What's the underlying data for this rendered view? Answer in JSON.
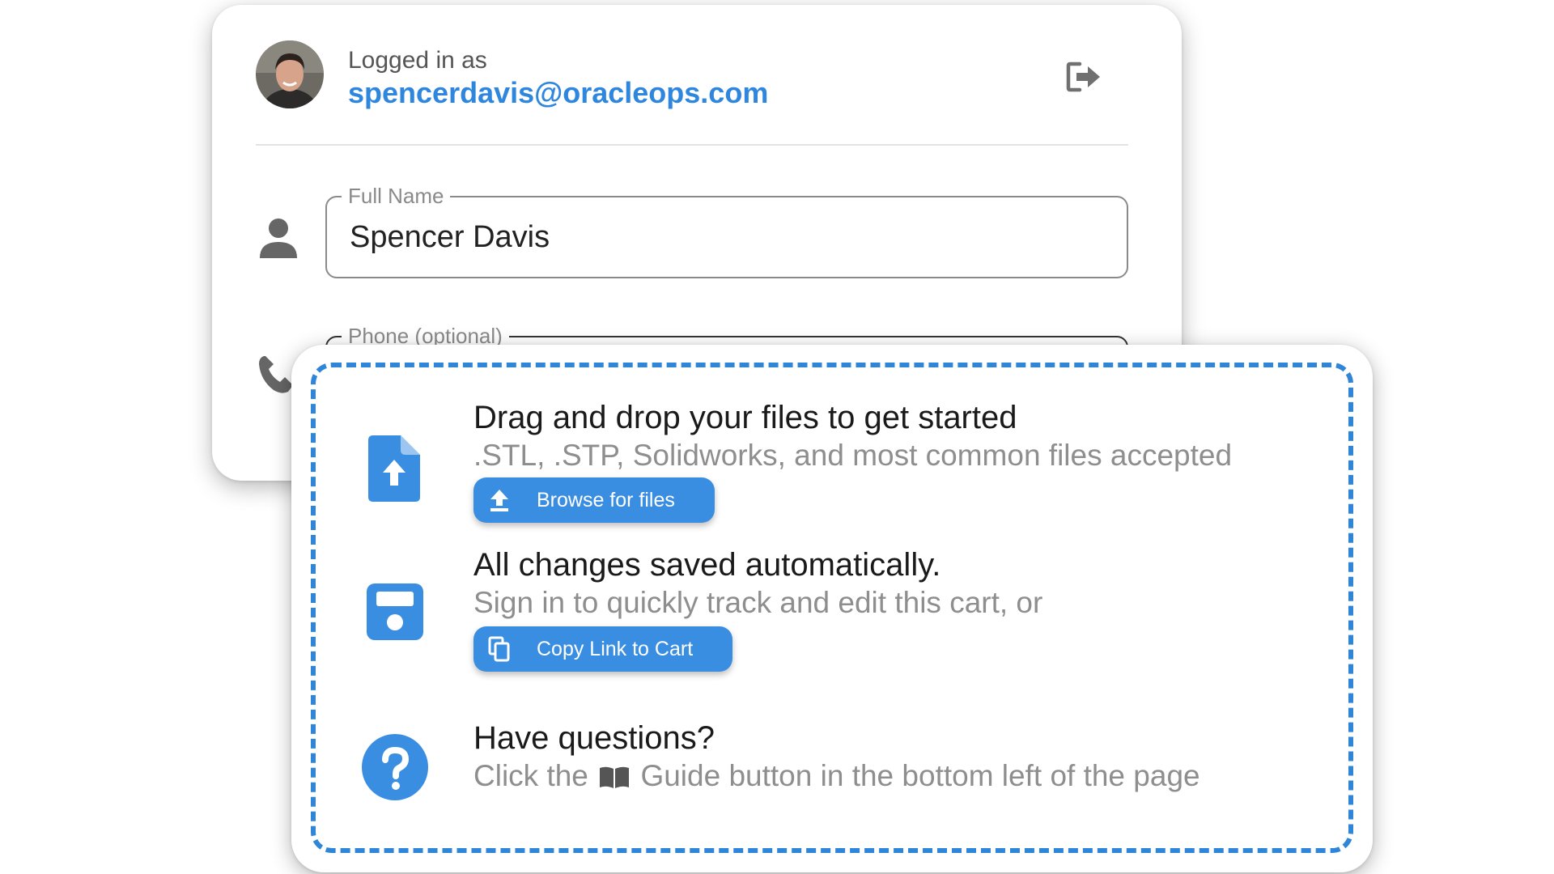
{
  "account": {
    "caption": "Logged in as",
    "email": "spencerdavis@oracleops.com",
    "avatar_icon": "user-photo-avatar",
    "logout_icon": "logout-icon"
  },
  "form": {
    "full_name": {
      "label": "Full Name",
      "value": "Spencer Davis",
      "icon": "person-icon"
    },
    "phone": {
      "label": "Phone (optional)",
      "icon": "phone-icon"
    }
  },
  "upload": {
    "title": "Drag and drop your files to get started",
    "subtitle": ".STL, .STP, Solidworks, and most common files accepted",
    "button_label": "Browse for files",
    "icon": "file-upload-icon",
    "button_icon": "upload-arrow-icon"
  },
  "autosave": {
    "title": "All changes saved automatically.",
    "subtitle": "Sign in to quickly track and edit this cart, or",
    "button_label": "Copy Link to Cart",
    "icon": "floppy-disk-icon",
    "button_icon": "copy-icon"
  },
  "help": {
    "title": "Have questions?",
    "subtitle_before": "Click the",
    "subtitle_after": "Guide button in the bottom left of the page",
    "icon": "question-circle-icon",
    "inline_icon": "book-icon"
  },
  "colors": {
    "accent": "#2e86de",
    "button": "#3a8ee2",
    "dash": "#2f86d8",
    "muted_text": "#8e8e8e",
    "icon_gray": "#666666"
  }
}
